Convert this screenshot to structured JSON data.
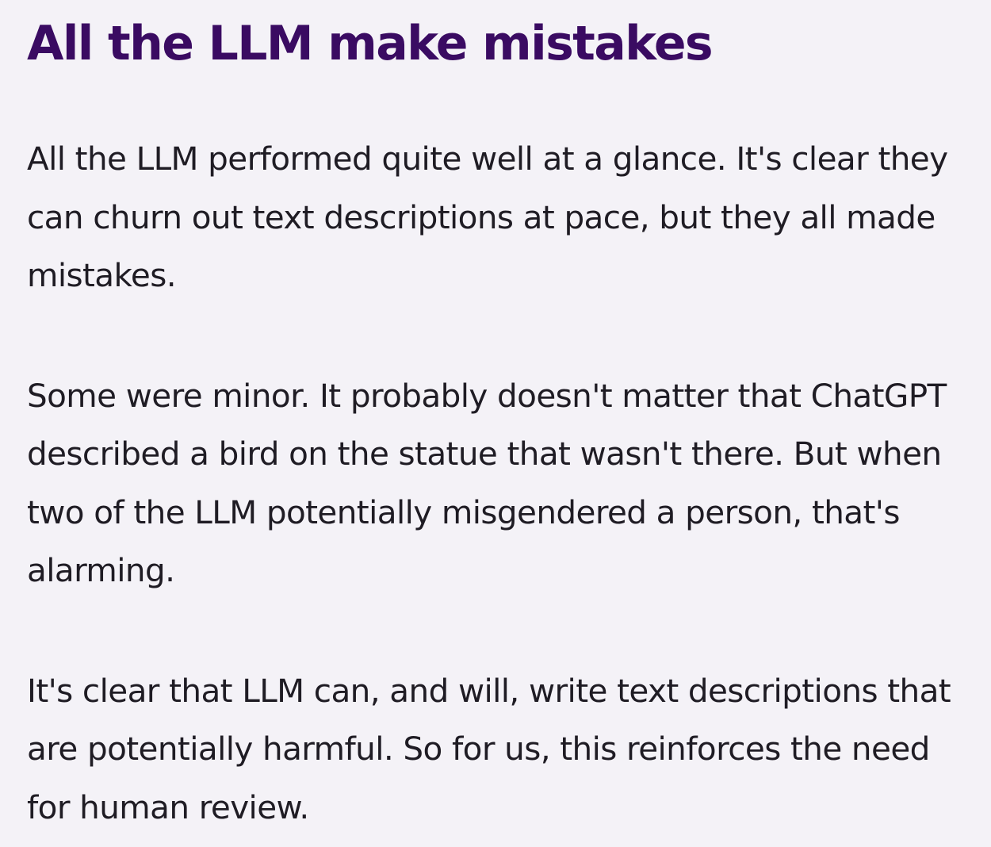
{
  "colors": {
    "background": "#f4f2f7",
    "heading": "#3a0b62",
    "body_text": "#1f1c24"
  },
  "article": {
    "heading": "All the LLM make mistakes",
    "paragraphs": [
      "All the LLM performed quite well at a glance. It's clear they can churn out text descriptions at pace, but they all made mistakes.",
      "Some were minor. It probably doesn't matter that ChatGPT described a bird on the statue that wasn't there. But when two of the LLM potentially misgendered a person, that's alarming.",
      "It's clear that LLM can, and will, write text descriptions that are potentially harmful. So for us, this reinforces the need for human review."
    ]
  }
}
